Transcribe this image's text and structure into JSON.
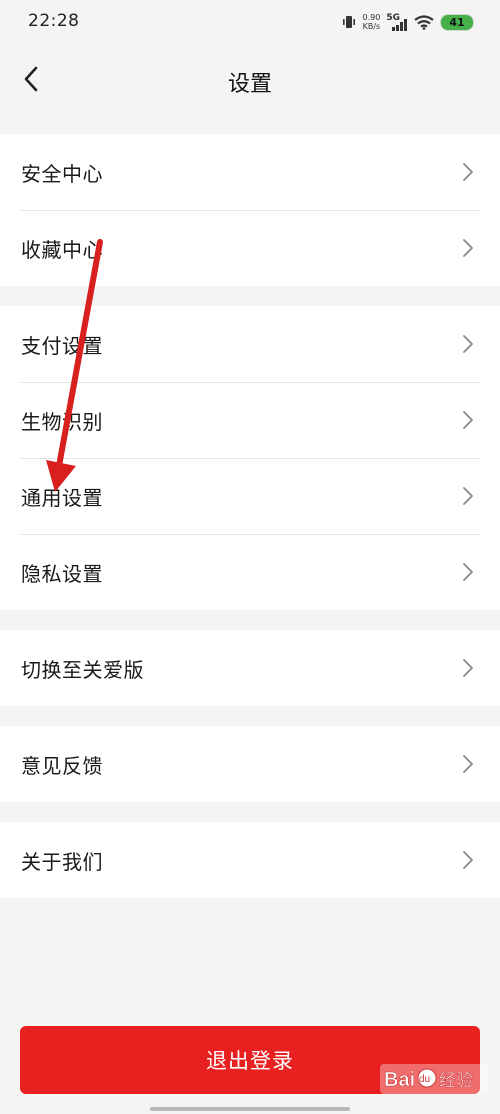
{
  "status_bar": {
    "time": "22:28",
    "speed_value": "0.90",
    "speed_unit": "KB/s",
    "network": "5G",
    "battery": "41"
  },
  "header": {
    "title": "设置",
    "back_icon": "chevron-left-icon"
  },
  "groups": [
    {
      "items": [
        {
          "label": "安全中心"
        },
        {
          "label": "收藏中心"
        }
      ]
    },
    {
      "items": [
        {
          "label": "支付设置"
        },
        {
          "label": "生物识别"
        },
        {
          "label": "通用设置"
        },
        {
          "label": "隐私设置"
        }
      ]
    },
    {
      "items": [
        {
          "label": "切换至关爱版"
        }
      ]
    },
    {
      "items": [
        {
          "label": "意见反馈"
        }
      ]
    },
    {
      "items": [
        {
          "label": "关于我们"
        }
      ]
    }
  ],
  "logout": {
    "label": "退出登录"
  },
  "watermark": {
    "text": "Bai经验"
  },
  "colors": {
    "accent": "#e8201f",
    "annotation": "#d8201f",
    "background": "#f4f4f4",
    "battery": "#47b04b"
  }
}
